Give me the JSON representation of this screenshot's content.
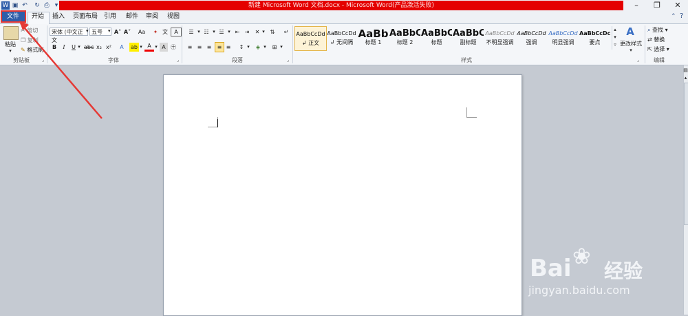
{
  "titlebar": {
    "title": "新建 Microsoft Word 文档.docx - Microsoft Word(产品激活失败)"
  },
  "tabs": {
    "file": "文件",
    "home": "开始",
    "insert": "插入",
    "layout": "页面布局",
    "references": "引用",
    "mailings": "邮件",
    "review": "审阅",
    "view": "视图"
  },
  "clipboard": {
    "paste": "粘贴",
    "cut": "剪切",
    "copy": "复制",
    "format_painter": "格式刷",
    "group": "剪贴板"
  },
  "font": {
    "family": "宋体 (中文正文",
    "size": "五号",
    "group": "字体",
    "bold": "B",
    "italic": "I",
    "underline": "U",
    "strike": "abc",
    "sub": "x₂",
    "sup": "x²",
    "grow": "A˄",
    "shrink": "A˅",
    "change_case": "Aa",
    "clear": "A",
    "color_a": "A",
    "highlight": "ab",
    "char_border": "A"
  },
  "paragraph": {
    "group": "段落"
  },
  "styles": {
    "group": "样式",
    "items": [
      {
        "sample": "AaBbCcDd",
        "name": "正文"
      },
      {
        "sample": "AaBbCcDd",
        "name": "无间隔"
      },
      {
        "sample": "AaBb",
        "name": "标题 1"
      },
      {
        "sample": "AaBbC",
        "name": "标题 2"
      },
      {
        "sample": "AaBbC",
        "name": "标题"
      },
      {
        "sample": "AaBbC",
        "name": "副标题"
      },
      {
        "sample": "AaBbCcDd",
        "name": "不明显强调"
      },
      {
        "sample": "AaBbCcDd",
        "name": "强调"
      },
      {
        "sample": "AaBbCcDd",
        "name": "明显强调"
      },
      {
        "sample": "AaBbCcDc",
        "name": "要点"
      }
    ],
    "change_styles": "更改样式"
  },
  "editing": {
    "find": "查找",
    "replace": "替换",
    "select": "选择",
    "group": "编辑"
  },
  "watermark": {
    "brand": "Bai",
    "suffix": "经验",
    "url": "jingyan.baidu.com"
  },
  "colors": {
    "title_red": "#e40000",
    "file_blue": "#2f5ea9",
    "arrow_red": "#e53935"
  }
}
